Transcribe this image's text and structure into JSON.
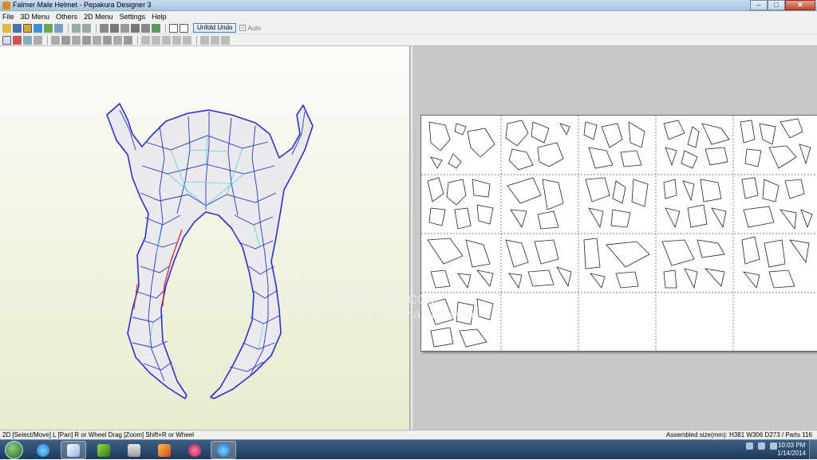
{
  "window": {
    "title": "Falmer Male Helmet - Pepakura Designer 3",
    "minimize": "–",
    "maximize": "□",
    "close": "✕"
  },
  "menu": [
    "File",
    "3D Menu",
    "Others",
    "2D Menu",
    "Settings",
    "Help"
  ],
  "toolbar": {
    "unfold_undo": "Unfold Undo",
    "auto_label": "Auto",
    "auto_checked": true
  },
  "watermark": {
    "line1": "WWW.DEVIANTART.COM",
    "line2": "(c) ZombieGrimm.deviantart.com",
    "logo": "devian"
  },
  "status": {
    "left": "2D [Select/Move] L [Pan] R or Wheel Drag [Zoom] Shift+R or Wheel",
    "right": "Assembled size(mm): H381 W306 D273 / Parts 116"
  },
  "clock": {
    "time": "10:03 PM",
    "date": "1/14/2014"
  },
  "icons": {
    "title": "pepakura-app-icon",
    "taskbar": [
      "ie-icon",
      "pepakura-icon",
      "spore-icon",
      "explorer-icon",
      "paint-icon",
      "atom-icon",
      "ie-icon"
    ]
  }
}
